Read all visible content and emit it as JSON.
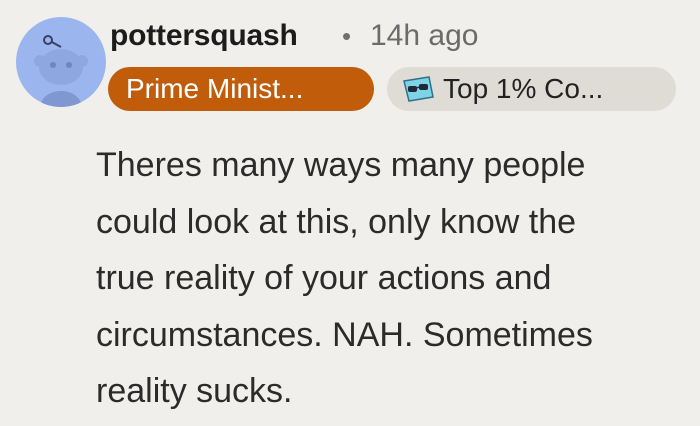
{
  "comment": {
    "author": "pottersquash",
    "separator": "•",
    "timestamp": "14h ago",
    "flairs": [
      {
        "label": "Prime Minist...",
        "color": "#c15c0a"
      },
      {
        "label": "Top 1% Co...",
        "icon": "sunglasses-emoji-icon"
      }
    ],
    "lines": [
      "Theres many ways many people",
      "could look at this, only know the",
      "true reality of your actions and",
      "circumstances. NAH. Sometimes",
      "reality sucks."
    ]
  },
  "colors": {
    "background": "#f0efeb",
    "avatar": "#9bb6ee",
    "flair_primary": "#c15c0a",
    "flair_secondary": "#dfdcd6"
  }
}
